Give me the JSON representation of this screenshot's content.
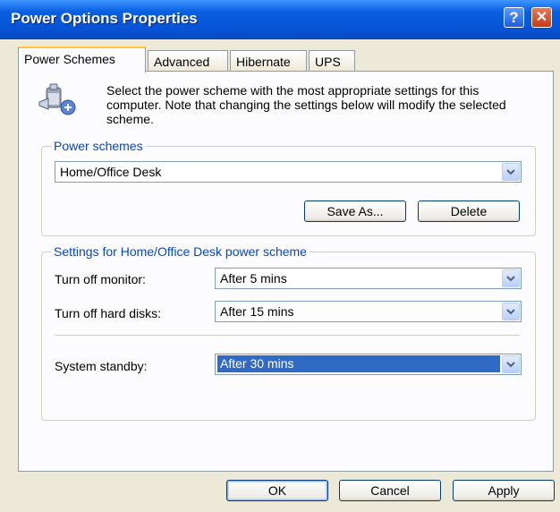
{
  "window": {
    "title": "Power Options Properties"
  },
  "titlebar": {
    "help_glyph": "?",
    "close_glyph": "✕"
  },
  "tabs": [
    {
      "label": "Power Schemes",
      "active": true
    },
    {
      "label": "Advanced",
      "active": false
    },
    {
      "label": "Hibernate",
      "active": false
    },
    {
      "label": "UPS",
      "active": false
    }
  ],
  "description": "Select the power scheme with the most appropriate settings for this computer. Note that changing the settings below will modify the selected scheme.",
  "power_schemes": {
    "legend": "Power schemes",
    "selected": "Home/Office Desk",
    "save_as_label": "Save As...",
    "delete_label": "Delete"
  },
  "settings": {
    "legend": "Settings for Home/Office Desk power scheme",
    "monitor": {
      "label": "Turn off monitor:",
      "value": "After 5 mins"
    },
    "hard_disks": {
      "label": "Turn off hard disks:",
      "value": "After 15 mins"
    },
    "standby": {
      "label": "System standby:",
      "value": "After 30 mins"
    }
  },
  "footer": {
    "ok_label": "OK",
    "cancel_label": "Cancel",
    "apply_label": "Apply"
  },
  "colors": {
    "titlebar": "#0554d6",
    "legend_text": "#0046d5",
    "selection": "#316ac5",
    "dialog_bg": "#ece9d8"
  },
  "icons": {
    "scheme_icon": "power-scheme-icon",
    "dropdown": "chevron-down-icon"
  }
}
